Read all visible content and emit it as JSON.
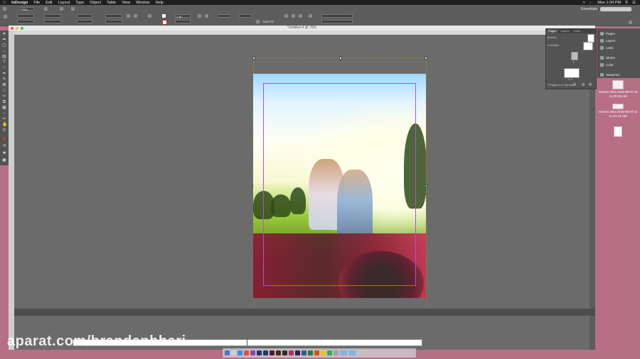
{
  "menubar": {
    "app_name": "InDesign",
    "items": [
      "File",
      "Edit",
      "Layout",
      "Type",
      "Object",
      "Table",
      "View",
      "Window",
      "Help"
    ],
    "clock": "Mon 1:34 PM"
  },
  "control": {
    "zoom": "75%",
    "workspace": "Essentials",
    "field_stroke": "1 pt",
    "field_autofit": "Auto-Fit"
  },
  "document": {
    "title": "*Untitled-4 @ 75%"
  },
  "pages_panel": {
    "tabs": [
      "Pages",
      "Layers",
      "Links"
    ],
    "master_none": "[None]",
    "master_a": "A-Master",
    "page_number": "1",
    "spread_label": "2-3",
    "status": "3 Pages in 2 Spreads"
  },
  "dock": {
    "items": [
      {
        "label": "Pages",
        "icon": "pages-icon"
      },
      {
        "label": "Layers",
        "icon": "layers-icon"
      },
      {
        "label": "Links",
        "icon": "links-icon"
      },
      {
        "label": "Stroke",
        "icon": "stroke-icon"
      },
      {
        "label": "Color",
        "icon": "color-icon"
      },
      {
        "label": "Swatches",
        "icon": "swatches-icon"
      }
    ]
  },
  "desktop": [
    {
      "label": "Screen Shot 2015-05-07 at 11.00.34 AM"
    },
    {
      "label": "Screen Shot 2015-05-07 at 11.01.12 AM"
    }
  ],
  "watermark": "aparat.com/brandanbhari",
  "colors": {
    "menubar": "#1f1f1f",
    "panel": "#535353",
    "pasteboard": "#6b6b6b",
    "margin_guide": "#b04fd6",
    "desktop": "#b76f86"
  }
}
